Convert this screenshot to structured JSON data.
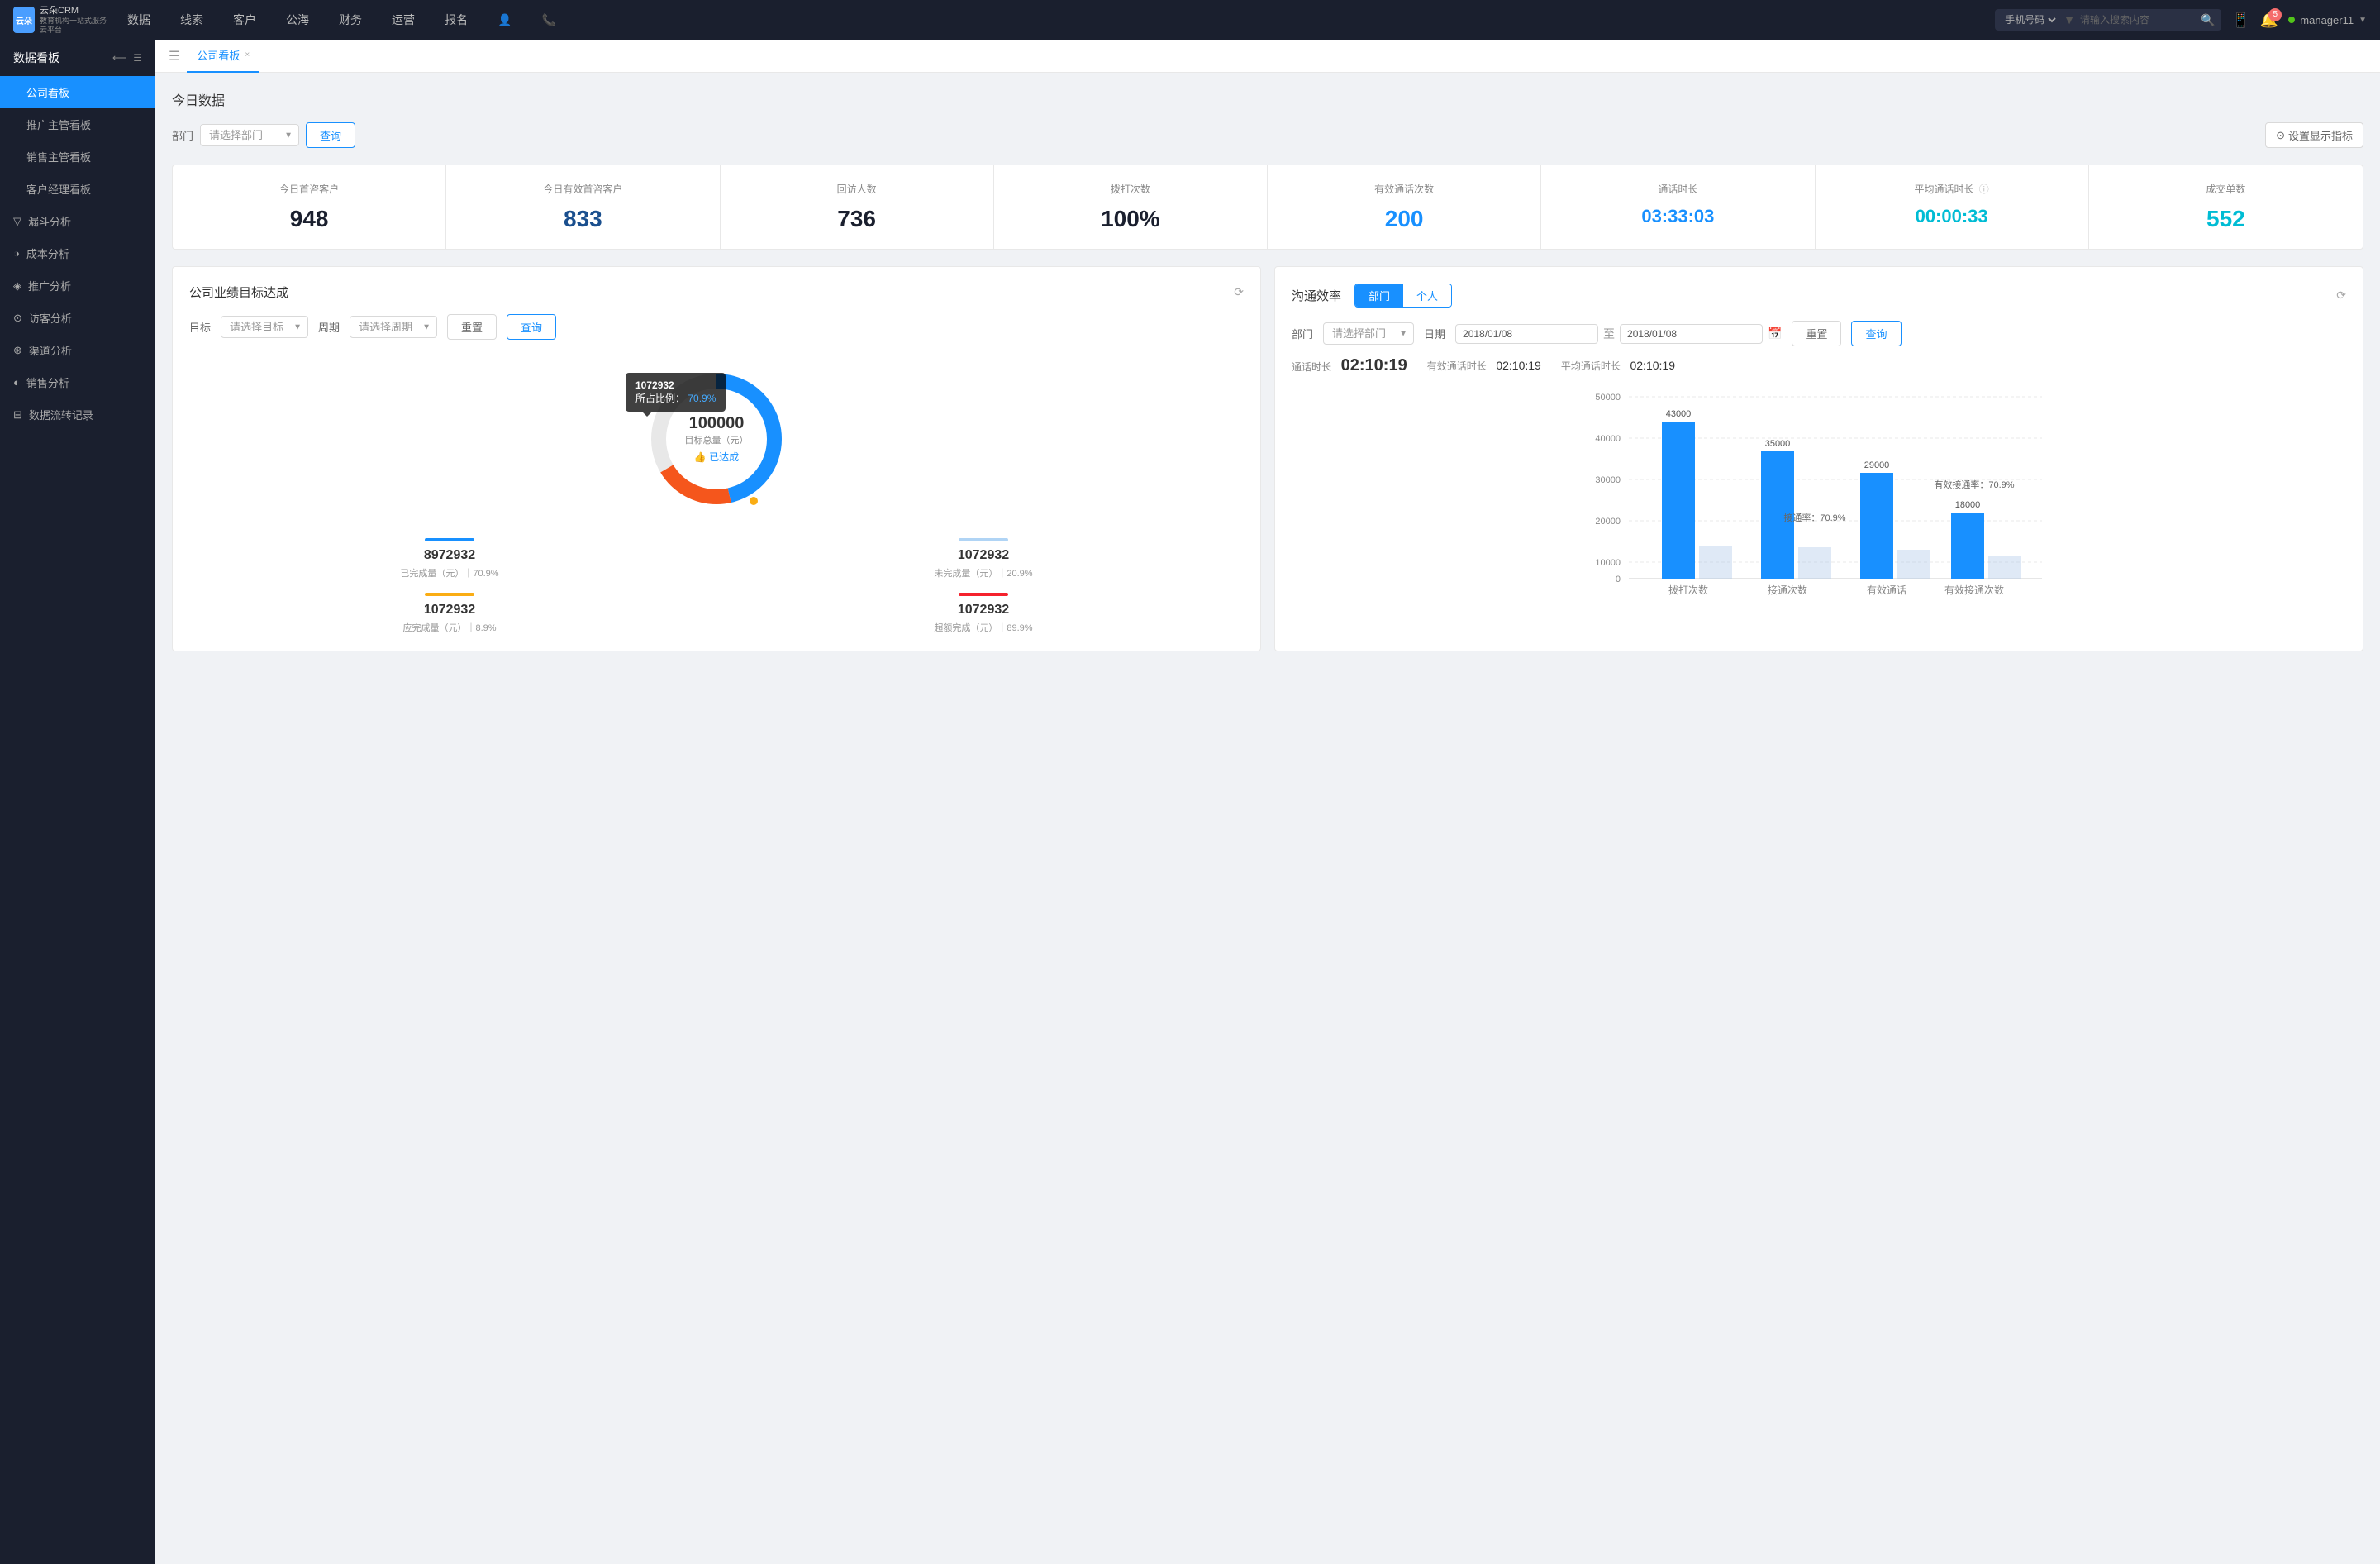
{
  "nav": {
    "logo_text1": "云朵CRM",
    "logo_text2": "教育机构一站式服务云平台",
    "items": [
      "数据",
      "线索",
      "客户",
      "公海",
      "财务",
      "运营",
      "报名"
    ],
    "search_placeholder": "请输入搜索内容",
    "search_type": "手机号码",
    "notif_count": "5",
    "username": "manager11"
  },
  "sidebar": {
    "section_title": "数据看板",
    "items": [
      {
        "label": "公司看板",
        "active": true
      },
      {
        "label": "推广主管看板",
        "active": false
      },
      {
        "label": "销售主管看板",
        "active": false
      },
      {
        "label": "客户经理看板",
        "active": false
      }
    ],
    "groups": [
      {
        "label": "漏斗分析",
        "icon": "▽"
      },
      {
        "label": "成本分析",
        "icon": "◑"
      },
      {
        "label": "推广分析",
        "icon": "◈"
      },
      {
        "label": "访客分析",
        "icon": "⊙"
      },
      {
        "label": "渠道分析",
        "icon": "⊛"
      },
      {
        "label": "销售分析",
        "icon": "◐"
      },
      {
        "label": "数据流转记录",
        "icon": "⊟"
      }
    ]
  },
  "tab": {
    "label": "公司看板",
    "close": "×"
  },
  "today_data": {
    "title": "今日数据",
    "filter_label": "部门",
    "filter_placeholder": "请选择部门",
    "query_btn": "查询",
    "settings_btn": "设置显示指标",
    "stats": [
      {
        "label": "今日首咨客户",
        "value": "948",
        "color_class": "dark"
      },
      {
        "label": "今日有效首咨客户",
        "value": "833",
        "color_class": "blue-dark"
      },
      {
        "label": "回访人数",
        "value": "736",
        "color_class": "dark"
      },
      {
        "label": "拨打次数",
        "value": "100%",
        "color_class": "dark"
      },
      {
        "label": "有效通话次数",
        "value": "200",
        "color_class": "blue"
      },
      {
        "label": "通话时长",
        "value": "03:33:03",
        "color_class": "blue"
      },
      {
        "label": "平均通话时长",
        "value": "00:00:33",
        "color_class": "cyan"
      },
      {
        "label": "成交单数",
        "value": "552",
        "color_class": "cyan"
      }
    ]
  },
  "goal_panel": {
    "title": "公司业绩目标达成",
    "target_label": "目标",
    "target_placeholder": "请选择目标",
    "period_label": "周期",
    "period_placeholder": "请选择周期",
    "reset_btn": "重置",
    "query_btn": "查询",
    "tooltip_value": "1072932",
    "tooltip_percent": "70.9%",
    "tooltip_percent_label": "所占比例：",
    "center_value": "100000",
    "center_label": "目标总量（元）",
    "center_badge": "👍 已达成",
    "stats": [
      {
        "label": "已完成量（元）｜70.9%",
        "value": "8972932",
        "bar_class": "blue"
      },
      {
        "label": "未完成量（元）｜20.9%",
        "value": "1072932",
        "bar_class": "light-blue"
      },
      {
        "label": "应完成量（元）｜8.9%",
        "value": "1072932",
        "bar_class": "orange"
      },
      {
        "label": "超额完成（元）｜89.9%",
        "value": "1072932",
        "bar_class": "red"
      }
    ]
  },
  "efficiency_panel": {
    "title": "沟通效率",
    "tab_dept": "部门",
    "tab_person": "个人",
    "dept_label": "部门",
    "dept_placeholder": "请选择部门",
    "date_label": "日期",
    "date_from": "2018/01/08",
    "date_to": "2018/01/08",
    "date_sep": "至",
    "reset_btn": "重置",
    "query_btn": "查询",
    "time_stats": [
      {
        "label": "通话时长",
        "value": "02:10:19"
      },
      {
        "label": "有效通话时长",
        "value": "02:10:19"
      },
      {
        "label": "平均通话时长",
        "value": "02:10:19"
      }
    ],
    "chart": {
      "y_labels": [
        "50000",
        "40000",
        "30000",
        "20000",
        "10000",
        "0"
      ],
      "bars": [
        {
          "label": "拨打次数",
          "value1": 43000,
          "value2": 0,
          "label1": "43000",
          "label2": ""
        },
        {
          "label": "接通次数",
          "value1": 35000,
          "value2": 0,
          "rate": "接通率：70.9%",
          "label1": "35000",
          "label2": ""
        },
        {
          "label": "有效通话",
          "value1": 29000,
          "value2": 0,
          "label1": "29000",
          "label2": ""
        },
        {
          "label": "有效接通次数",
          "value1": 18000,
          "value2": 0,
          "rate": "有效接通率：70.9%",
          "label1": "18000",
          "label2": ""
        }
      ]
    }
  }
}
